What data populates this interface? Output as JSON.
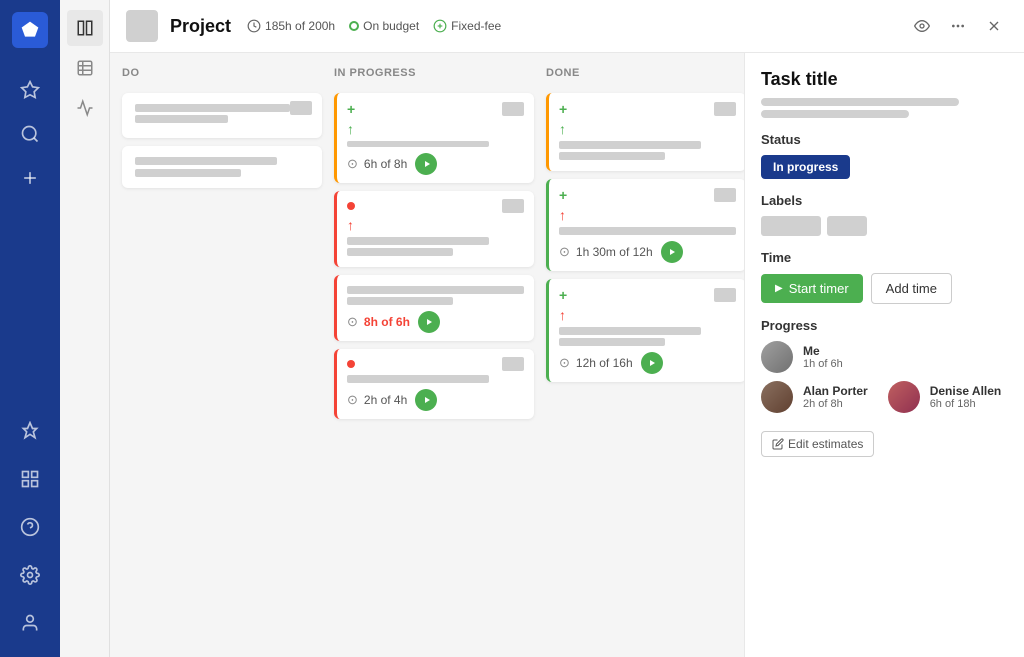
{
  "app": {
    "logo_icon": "diamond-icon"
  },
  "left_nav": {
    "items": [
      {
        "id": "star",
        "icon": "star-icon",
        "label": "Favorites"
      },
      {
        "id": "search",
        "icon": "search-icon",
        "label": "Search"
      },
      {
        "id": "add",
        "icon": "plus-icon",
        "label": "Add"
      }
    ],
    "bottom_items": [
      {
        "id": "pin",
        "icon": "pin-icon",
        "label": "Pin"
      },
      {
        "id": "grid",
        "icon": "grid-icon",
        "label": "Apps"
      },
      {
        "id": "help",
        "icon": "help-icon",
        "label": "Help"
      },
      {
        "id": "settings",
        "icon": "settings-icon",
        "label": "Settings"
      },
      {
        "id": "user",
        "icon": "user-icon",
        "label": "User"
      }
    ]
  },
  "second_sidebar": {
    "items": [
      {
        "id": "board",
        "icon": "board-icon",
        "active": true
      },
      {
        "id": "table",
        "icon": "table-icon",
        "active": false
      },
      {
        "id": "chart",
        "icon": "chart-icon",
        "active": false
      }
    ]
  },
  "header": {
    "project_title": "Project",
    "time_logged": "185h of 200h",
    "budget_status": "On budget",
    "fee_type": "Fixed-fee",
    "actions": {
      "view": "view-icon",
      "more": "more-icon",
      "close": "close-icon"
    }
  },
  "kanban": {
    "columns": [
      {
        "id": "todo",
        "title": "DO",
        "cards": [
          {
            "id": "t1",
            "bars": [
              "long",
              "short"
            ],
            "border": "none"
          },
          {
            "id": "t2",
            "bars": [
              "medium"
            ],
            "border": "none"
          }
        ]
      },
      {
        "id": "in_progress",
        "title": "IN PROGRESS",
        "cards": [
          {
            "id": "ip1",
            "border": "orange",
            "has_add": true,
            "has_arrow_green": true,
            "time": "6h of 8h",
            "time_color": "normal",
            "has_play": true
          },
          {
            "id": "ip2",
            "border": "red",
            "has_dot": true,
            "has_arrow": true,
            "bars": [
              "medium",
              "short"
            ]
          },
          {
            "id": "ip3",
            "border": "red",
            "time": "8h of 6h",
            "time_color": "red",
            "has_play": true,
            "bars": [
              "long",
              "short"
            ]
          },
          {
            "id": "ip4",
            "border": "red",
            "has_dot": true,
            "bars": [
              "medium"
            ],
            "time": "2h of 4h",
            "time_color": "normal",
            "has_play": true
          }
        ]
      },
      {
        "id": "done",
        "title": "DONE",
        "cards": [
          {
            "id": "d1",
            "border": "orange",
            "has_add": true,
            "has_arrow_green": true,
            "bars": [
              "long",
              "short"
            ]
          },
          {
            "id": "d2",
            "border": "green",
            "has_add": true,
            "has_arrow": true,
            "bars": [
              "long",
              "short"
            ],
            "time": "1h 30m of 12h",
            "time_color": "normal",
            "has_play": true
          },
          {
            "id": "d3",
            "border": "green",
            "has_add": true,
            "has_arrow": true,
            "bars": [
              "long",
              "short"
            ],
            "time": "12h of 16h",
            "time_color": "normal",
            "has_play": true
          }
        ]
      }
    ]
  },
  "right_panel": {
    "task_title": "Task title",
    "status": {
      "label": "Status",
      "value": "In progress"
    },
    "labels": {
      "label": "Labels"
    },
    "time": {
      "label": "Time",
      "start_timer": "Start timer",
      "add_time": "Add time"
    },
    "progress": {
      "label": "Progress",
      "me": {
        "name": "Me",
        "time": "1h of 6h"
      },
      "user1": {
        "name": "Alan Porter",
        "time": "2h of 8h"
      },
      "user2": {
        "name": "Denise Allen",
        "time": "6h of 18h"
      }
    },
    "edit_estimates": "Edit estimates"
  }
}
